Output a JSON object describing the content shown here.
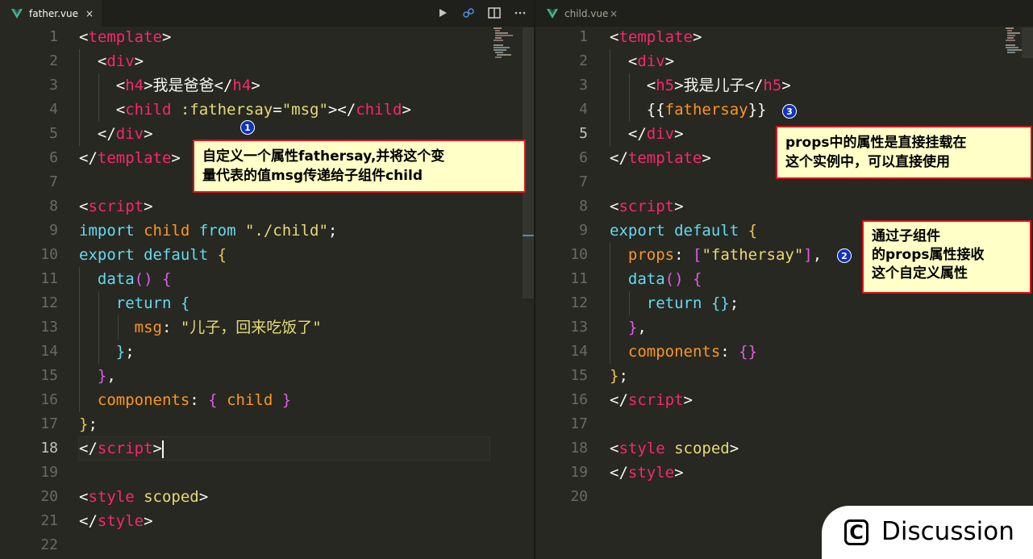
{
  "colors": {
    "tag": "#f92672",
    "attribute": "#e6db74",
    "keyword": "#66d9ef",
    "brace": "#f3c64b",
    "string": "#e6db74",
    "note_border": "#d6141d",
    "note_bg": "#ffffc7",
    "badge": "#1133bb"
  },
  "left_editor": {
    "tab": {
      "icon": "vue-logo-icon",
      "label": "father.vue",
      "close": "×"
    },
    "toolbar": [
      "run-icon",
      "compare-icon",
      "split-editor-icon",
      "more-icon"
    ],
    "current_line": 18,
    "lines": [
      {
        "n": "1",
        "tokens": [
          [
            "p",
            "<"
          ],
          [
            "t",
            "template"
          ],
          [
            "p",
            ">"
          ]
        ]
      },
      {
        "n": "2",
        "tokens": [
          [
            "p",
            "  <"
          ],
          [
            "t",
            "div"
          ],
          [
            "p",
            ">"
          ]
        ]
      },
      {
        "n": "3",
        "tokens": [
          [
            "p",
            "    <"
          ],
          [
            "t",
            "h4"
          ],
          [
            "p",
            ">我是爸爸</"
          ],
          [
            "t",
            "h4"
          ],
          [
            "p",
            ">"
          ]
        ]
      },
      {
        "n": "4",
        "tokens": [
          [
            "p",
            "    <"
          ],
          [
            "t",
            "child"
          ],
          [
            "p",
            " "
          ],
          [
            "a",
            ":fathersay"
          ],
          [
            "p",
            "="
          ],
          [
            "s",
            "\"msg\""
          ],
          [
            "p",
            "></"
          ],
          [
            "t",
            "child"
          ],
          [
            "p",
            ">"
          ]
        ]
      },
      {
        "n": "5",
        "tokens": [
          [
            "p",
            "  </"
          ],
          [
            "t",
            "div"
          ],
          [
            "p",
            ">"
          ]
        ]
      },
      {
        "n": "6",
        "tokens": [
          [
            "p",
            "</"
          ],
          [
            "t",
            "template"
          ],
          [
            "p",
            ">"
          ]
        ]
      },
      {
        "n": "7",
        "tokens": []
      },
      {
        "n": "8",
        "tokens": [
          [
            "p",
            "<"
          ],
          [
            "t",
            "script"
          ],
          [
            "p",
            ">"
          ]
        ]
      },
      {
        "n": "9",
        "tokens": [
          [
            "k",
            "import"
          ],
          [
            "p",
            " "
          ],
          [
            "o",
            "child"
          ],
          [
            "p",
            " "
          ],
          [
            "k",
            "from"
          ],
          [
            "p",
            " "
          ],
          [
            "s",
            "\"./child\""
          ],
          [
            "p",
            ";"
          ]
        ]
      },
      {
        "n": "10",
        "tokens": [
          [
            "k",
            "export"
          ],
          [
            "p",
            " "
          ],
          [
            "k",
            "default"
          ],
          [
            "p",
            " "
          ],
          [
            "y",
            "{"
          ]
        ]
      },
      {
        "n": "11",
        "tokens": [
          [
            "p",
            "  "
          ],
          [
            "k",
            "data"
          ],
          [
            "pk",
            "()"
          ],
          [
            "p",
            " "
          ],
          [
            "pk",
            "{"
          ]
        ]
      },
      {
        "n": "12",
        "tokens": [
          [
            "p",
            "    "
          ],
          [
            "k",
            "return"
          ],
          [
            "p",
            " "
          ],
          [
            "k",
            "{"
          ]
        ]
      },
      {
        "n": "13",
        "tokens": [
          [
            "p",
            "      "
          ],
          [
            "o",
            "msg"
          ],
          [
            "p",
            ": "
          ],
          [
            "s",
            "\"儿子，回来吃饭了\""
          ]
        ]
      },
      {
        "n": "14",
        "tokens": [
          [
            "p",
            "    "
          ],
          [
            "k",
            "}"
          ],
          [
            "p",
            ";"
          ]
        ]
      },
      {
        "n": "15",
        "tokens": [
          [
            "p",
            "  "
          ],
          [
            "pk",
            "}"
          ],
          [
            "p",
            ","
          ]
        ]
      },
      {
        "n": "16",
        "tokens": [
          [
            "p",
            "  "
          ],
          [
            "o",
            "components"
          ],
          [
            "p",
            ": "
          ],
          [
            "pk",
            "{"
          ],
          [
            "p",
            " "
          ],
          [
            "o",
            "child"
          ],
          [
            "p",
            " "
          ],
          [
            "pk",
            "}"
          ]
        ]
      },
      {
        "n": "17",
        "tokens": [
          [
            "y",
            "}"
          ],
          [
            "p",
            ";"
          ]
        ]
      },
      {
        "n": "18",
        "tokens": [
          [
            "p",
            "</"
          ],
          [
            "t",
            "script"
          ],
          [
            "p",
            ">"
          ]
        ]
      },
      {
        "n": "19",
        "tokens": []
      },
      {
        "n": "20",
        "tokens": [
          [
            "p",
            "<"
          ],
          [
            "t",
            "style"
          ],
          [
            "p",
            " "
          ],
          [
            "a",
            "scoped"
          ],
          [
            "p",
            ">"
          ]
        ]
      },
      {
        "n": "21",
        "tokens": [
          [
            "p",
            "</"
          ],
          [
            "t",
            "style"
          ],
          [
            "p",
            ">"
          ]
        ]
      },
      {
        "n": "22",
        "tokens": []
      }
    ]
  },
  "right_editor": {
    "tab": {
      "icon": "vue-logo-icon",
      "label": "child.vue",
      "close": "×"
    },
    "current_line": 5,
    "lines": [
      {
        "n": "1",
        "tokens": [
          [
            "p",
            "<"
          ],
          [
            "t",
            "template"
          ],
          [
            "p",
            ">"
          ]
        ]
      },
      {
        "n": "2",
        "tokens": [
          [
            "p",
            "  <"
          ],
          [
            "t",
            "div"
          ],
          [
            "p",
            ">"
          ]
        ]
      },
      {
        "n": "3",
        "tokens": [
          [
            "p",
            "    <"
          ],
          [
            "t",
            "h5"
          ],
          [
            "p",
            ">我是儿子</"
          ],
          [
            "t",
            "h5"
          ],
          [
            "p",
            ">"
          ]
        ]
      },
      {
        "n": "4",
        "tokens": [
          [
            "p",
            "    {{"
          ],
          [
            "o",
            "fathersay"
          ],
          [
            "p",
            "}}"
          ]
        ]
      },
      {
        "n": "5",
        "tokens": [
          [
            "p",
            "  </"
          ],
          [
            "t",
            "div"
          ],
          [
            "p",
            ">"
          ]
        ]
      },
      {
        "n": "6",
        "tokens": [
          [
            "p",
            "</"
          ],
          [
            "t",
            "template"
          ],
          [
            "p",
            ">"
          ]
        ]
      },
      {
        "n": "7",
        "tokens": []
      },
      {
        "n": "8",
        "tokens": [
          [
            "p",
            "<"
          ],
          [
            "t",
            "script"
          ],
          [
            "p",
            ">"
          ]
        ]
      },
      {
        "n": "9",
        "tokens": [
          [
            "k",
            "export"
          ],
          [
            "p",
            " "
          ],
          [
            "k",
            "default"
          ],
          [
            "p",
            " "
          ],
          [
            "y",
            "{"
          ]
        ]
      },
      {
        "n": "10",
        "tokens": [
          [
            "p",
            "  "
          ],
          [
            "o",
            "props"
          ],
          [
            "p",
            ": "
          ],
          [
            "pk",
            "["
          ],
          [
            "s",
            "\"fathersay\""
          ],
          [
            "pk",
            "]"
          ],
          [
            "p",
            ","
          ]
        ]
      },
      {
        "n": "11",
        "tokens": [
          [
            "p",
            "  "
          ],
          [
            "k",
            "data"
          ],
          [
            "pk",
            "()"
          ],
          [
            "p",
            " "
          ],
          [
            "pk",
            "{"
          ]
        ]
      },
      {
        "n": "12",
        "tokens": [
          [
            "p",
            "    "
          ],
          [
            "k",
            "return"
          ],
          [
            "p",
            " "
          ],
          [
            "k",
            "{}"
          ],
          [
            "p",
            ";"
          ]
        ]
      },
      {
        "n": "13",
        "tokens": [
          [
            "p",
            "  "
          ],
          [
            "pk",
            "}"
          ],
          [
            "p",
            ","
          ]
        ]
      },
      {
        "n": "14",
        "tokens": [
          [
            "p",
            "  "
          ],
          [
            "o",
            "components"
          ],
          [
            "p",
            ": "
          ],
          [
            "pk",
            "{}"
          ]
        ]
      },
      {
        "n": "15",
        "tokens": [
          [
            "y",
            "}"
          ],
          [
            "p",
            ";"
          ]
        ]
      },
      {
        "n": "16",
        "tokens": [
          [
            "p",
            "</"
          ],
          [
            "t",
            "script"
          ],
          [
            "p",
            ">"
          ]
        ]
      },
      {
        "n": "17",
        "tokens": []
      },
      {
        "n": "18",
        "tokens": [
          [
            "p",
            "<"
          ],
          [
            "t",
            "style"
          ],
          [
            "p",
            " "
          ],
          [
            "a",
            "scoped"
          ],
          [
            "p",
            ">"
          ]
        ]
      },
      {
        "n": "19",
        "tokens": [
          [
            "p",
            "</"
          ],
          [
            "t",
            "style"
          ],
          [
            "p",
            ">"
          ]
        ]
      },
      {
        "n": "20",
        "tokens": []
      }
    ]
  },
  "annotations": {
    "badge1": "1",
    "badge2": "2",
    "badge3": "3",
    "note1": [
      "自定义一个属性fathersay,并将这个变",
      "量代表的值msg传递给子组件child"
    ],
    "note2": [
      "通过子组件",
      "的props属性接收",
      "这个自定义属性"
    ],
    "note3": [
      "props中的属性是直接挂载在",
      "这个实例中，可以直接使用"
    ]
  },
  "watermark": {
    "icon": "C",
    "label": "Discussion"
  }
}
